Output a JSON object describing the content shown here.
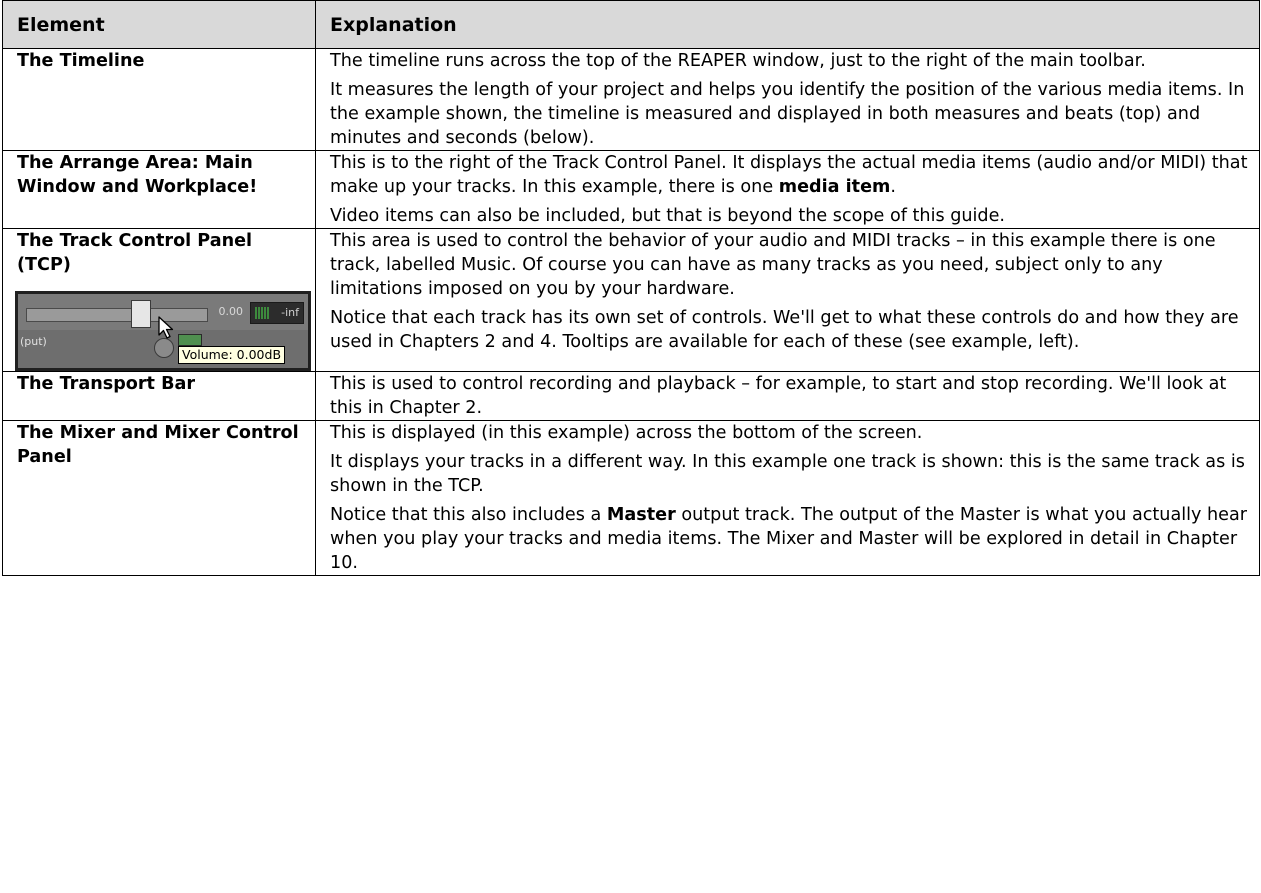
{
  "table": {
    "headers": [
      "Element",
      "Explanation"
    ],
    "rows": [
      {
        "element": "The Timeline",
        "paragraphs": [
          [
            "The timeline runs across the top of the REAPER window, just to the right of the main toolbar."
          ],
          [
            "It measures the length of your project and helps you identify the position of the various media items. In the example shown, the timeline is measured and displayed in both measures and beats (top) and minutes and seconds (below)."
          ]
        ]
      },
      {
        "element": "The Arrange Area: Main Window and Workplace!",
        "paragraphs": [
          [
            "This is to the right of the Track Control Panel. It displays the actual media items (audio and/or MIDI) that make up your tracks. In this example, there is one ",
            "media item",
            "."
          ],
          [
            "Video items can also be included, but that is beyond the scope of this guide."
          ]
        ]
      },
      {
        "element": "The Track Control Panel (TCP)",
        "paragraphs": [
          [
            "This area is used to control the behavior of your audio and MIDI tracks – in this example there is one track, labelled Music. Of course you can have as many tracks as you need, subject only to any limitations imposed on you by your hardware."
          ],
          [
            "Notice that each track has its own set of controls. We'll get to what these controls do and how they are used in Chapters 2 and 4. Tooltips are available for each of these (see example, left)."
          ]
        ]
      },
      {
        "element": "The Transport Bar",
        "paragraphs": [
          [
            "This is used to control recording and playback – for example, to start and stop recording. We'll look at this in Chapter 2."
          ]
        ]
      },
      {
        "element": "The Mixer and Mixer Control Panel",
        "paragraphs": [
          [
            "This is displayed (in this example) across the bottom of the screen."
          ],
          [
            "It displays your tracks in a different way. In this example one track is shown: this is the same track as is shown in the TCP."
          ],
          [
            "Notice that this also includes a ",
            "Master",
            " output track. The output of the Master is what you actually hear when you play your tracks and media items. The Mixer and Master will be explored in detail in Chapter 10."
          ]
        ]
      }
    ]
  },
  "tcp_screenshot": {
    "volume_value": "0.00",
    "meter_label": "-inf",
    "input_label": "(put)",
    "tooltip": "Volume: 0.00dB",
    "fader_level_fraction": 0.65,
    "icons": [
      "mouse-cursor-icon"
    ]
  }
}
